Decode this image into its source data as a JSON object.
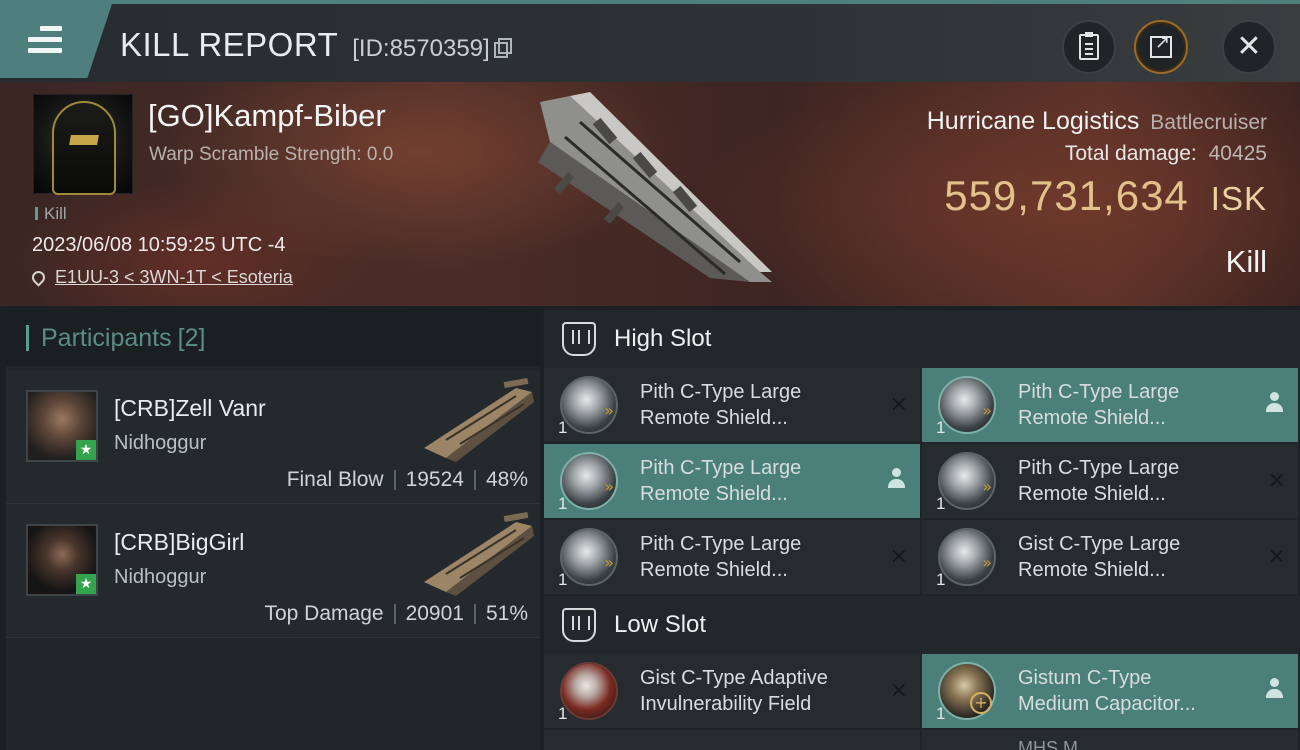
{
  "header": {
    "title": "KILL REPORT",
    "report_id": "[ID:8570359]",
    "icons": [
      "menu-icon",
      "copy-icon",
      "clipboard-icon",
      "share-icon",
      "close-icon"
    ]
  },
  "victim": {
    "name": "[GO]Kampf-Biber",
    "subtitle": "Warp Scramble Strength: 0.0",
    "kill_tag": "Kill",
    "datetime": "2023/06/08 10:59:25 UTC -4",
    "location": "E1UU-3 < 3WN-1T < Esoteria",
    "ship_name": "Hurricane Logistics",
    "ship_class": "Battlecruiser",
    "total_damage_label": "Total damage:",
    "total_damage": "40425",
    "isk_value": "559,731,634",
    "isk_unit": "ISK",
    "result": "Kill"
  },
  "participants": {
    "label": "Participants",
    "count": "[2]",
    "items": [
      {
        "name": "[CRB]Zell Vanr",
        "ship": "Nidhoggur",
        "stat_label": "Final Blow",
        "damage": "19524",
        "percent": "48%"
      },
      {
        "name": "[CRB]BigGirl",
        "ship": "Nidhoggur",
        "stat_label": "Top Damage",
        "damage": "20901",
        "percent": "51%"
      }
    ]
  },
  "fitting": {
    "high_slot": {
      "label": "High Slot",
      "modules": [
        {
          "qty": "1",
          "line1": "Pith C-Type Large",
          "line2": "Remote Shield...",
          "status": "×",
          "highlight": false
        },
        {
          "qty": "1",
          "line1": "Pith C-Type Large",
          "line2": "Remote Shield...",
          "status": "person",
          "highlight": true
        },
        {
          "qty": "1",
          "line1": "Pith C-Type Large",
          "line2": "Remote Shield...",
          "status": "person",
          "highlight": true
        },
        {
          "qty": "1",
          "line1": "Pith C-Type Large",
          "line2": "Remote Shield...",
          "status": "×",
          "highlight": false
        },
        {
          "qty": "1",
          "line1": "Pith C-Type Large",
          "line2": "Remote Shield...",
          "status": "×",
          "highlight": false
        },
        {
          "qty": "1",
          "line1": "Gist C-Type Large",
          "line2": "Remote Shield...",
          "status": "×",
          "highlight": false
        }
      ]
    },
    "low_slot": {
      "label": "Low Slot",
      "modules": [
        {
          "qty": "1",
          "line1": "Gist C-Type Adaptive",
          "line2": "Invulnerability Field",
          "status": "×",
          "highlight": false
        },
        {
          "qty": "1",
          "line1": "Gistum C-Type",
          "line2": "Medium Capacitor...",
          "status": "person",
          "highlight": true
        }
      ],
      "partial": [
        "...",
        "MHS M..."
      ]
    }
  }
}
